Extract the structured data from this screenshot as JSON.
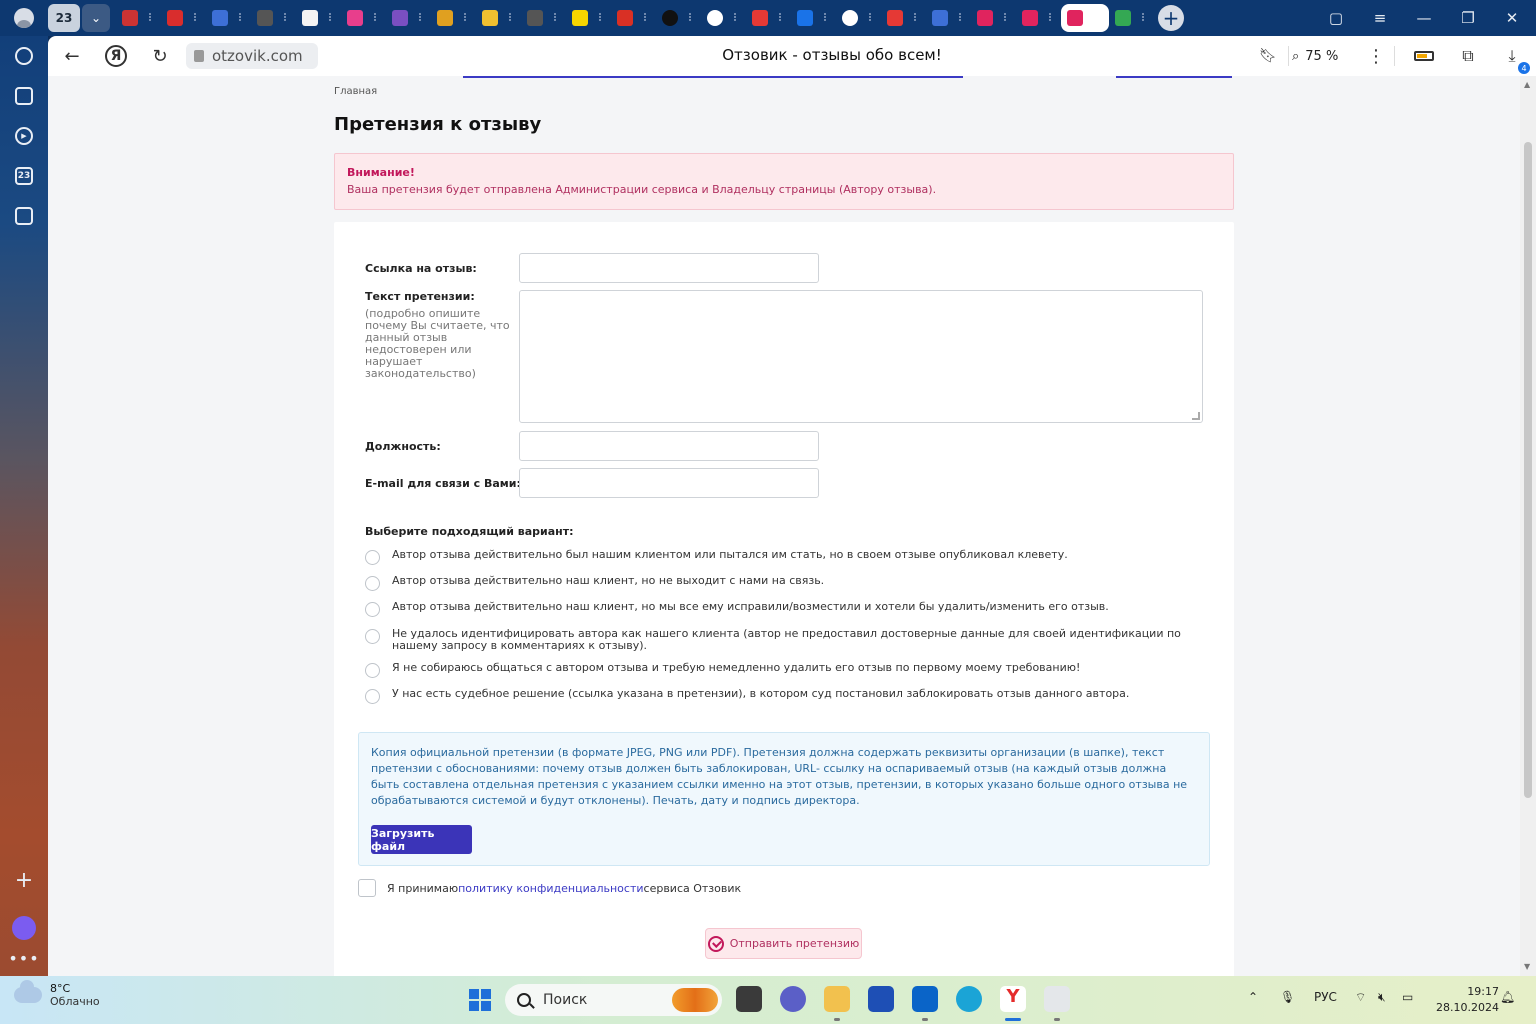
{
  "browser": {
    "group_count": "23",
    "tab_icon_names": [
      "tab-favicon-shortcut",
      "tab-favicon-pdf",
      "tab-favicon-docs",
      "tab-favicon-maps",
      "tab-favicon-star",
      "tab-favicon-pink",
      "tab-favicon-mail",
      "tab-favicon-circle",
      "tab-favicon-circle2",
      "tab-favicon-maps2",
      "tab-favicon-banana",
      "tab-favicon-gmail",
      "tab-favicon-f",
      "tab-favicon-sparkle",
      "tab-favicon-yandex",
      "tab-favicon-help",
      "tab-favicon-sparkle2",
      "tab-favicon-yandex2",
      "tab-favicon-docs2",
      "tab-favicon-otzovik",
      "tab-favicon-otzovik2",
      "tab-favicon-otzovik-active",
      "tab-favicon-drive"
    ],
    "url": "otzovik.com",
    "title": "Отзовик - отзывы обо всем!",
    "zoom": "75 %",
    "downloads_badge": "4",
    "yandex_btn": "Я",
    "sidebar_badge": "23"
  },
  "page": {
    "breadcrumb": "Главная",
    "heading": "Претензия к отзыву",
    "alert": {
      "title": "Внимание!",
      "text": "Ваша претензия будет отправлена Администрации сервиса и Владельцу страницы (Автору отзыва)."
    },
    "form": {
      "review_link_label": "Ссылка на отзыв:",
      "review_link_value": "",
      "claim_text_label": "Текст претензии:",
      "claim_text_hint": "(подробно опишите почему Вы считаете, что данный отзыв недостоверен или нарушает законодательство)",
      "claim_text_value": "",
      "position_label": "Должность:",
      "position_value": "",
      "email_label": "E-mail для связи с Вами:",
      "email_value": "",
      "options_title": "Выберите подходящий вариант:",
      "options": [
        "Автор отзыва действительно был нашим клиентом или пытался им стать, но в своем отзыве опубликовал клевету.",
        "Автор отзыва действительно наш клиент, но не выходит с нами на связь.",
        "Автор отзыва действительно наш клиент, но мы все ему исправили/возместили и хотели бы удалить/изменить его отзыв.",
        "Не удалось идентифицировать автора как нашего клиента (автор не предоставил достоверные данные для своей идентификации по нашему запросу в комментариях к отзыву).",
        "Я не собираюсь общаться с автором отзыва и требую немедленно удалить его отзыв по первому моему требованию!",
        "У нас есть судебное решение (ссылка указана в претензии), в котором суд постановил заблокировать отзыв данного автора."
      ],
      "upload_text": "Копия официальной претензии (в формате JPEG, PNG или PDF). Претензия должна содержать реквизиты организации (в шапке), текст претензии с обоснованиями: почему отзыв должен быть заблокирован, URL- ссылку на оспариваемый отзыв (на каждый отзыв должна быть составлена отдельная претензия с указанием ссылки именно на этот отзыв, претензии, в которых указано больше одного отзыва не обрабатываются системой и будут отклонены). Печать, дату и подпись директора.",
      "upload_button": "Загрузить файл",
      "consent_prefix": "Я принимаю ",
      "consent_link": "политику конфиденциальности",
      "consent_suffix": " сервиса Отзовик",
      "submit_button": "Отправить претензию"
    }
  },
  "taskbar": {
    "temperature": "8°C",
    "weather": "Облачно",
    "search_placeholder": "Поиск",
    "language": "РУС",
    "time": "19:17",
    "date": "28.10.2024"
  },
  "colors": {
    "accent": "#3b34b8",
    "alert_bg": "#fde9ec",
    "alert_text": "#b03060",
    "upload_bg": "#f0f8fd"
  }
}
